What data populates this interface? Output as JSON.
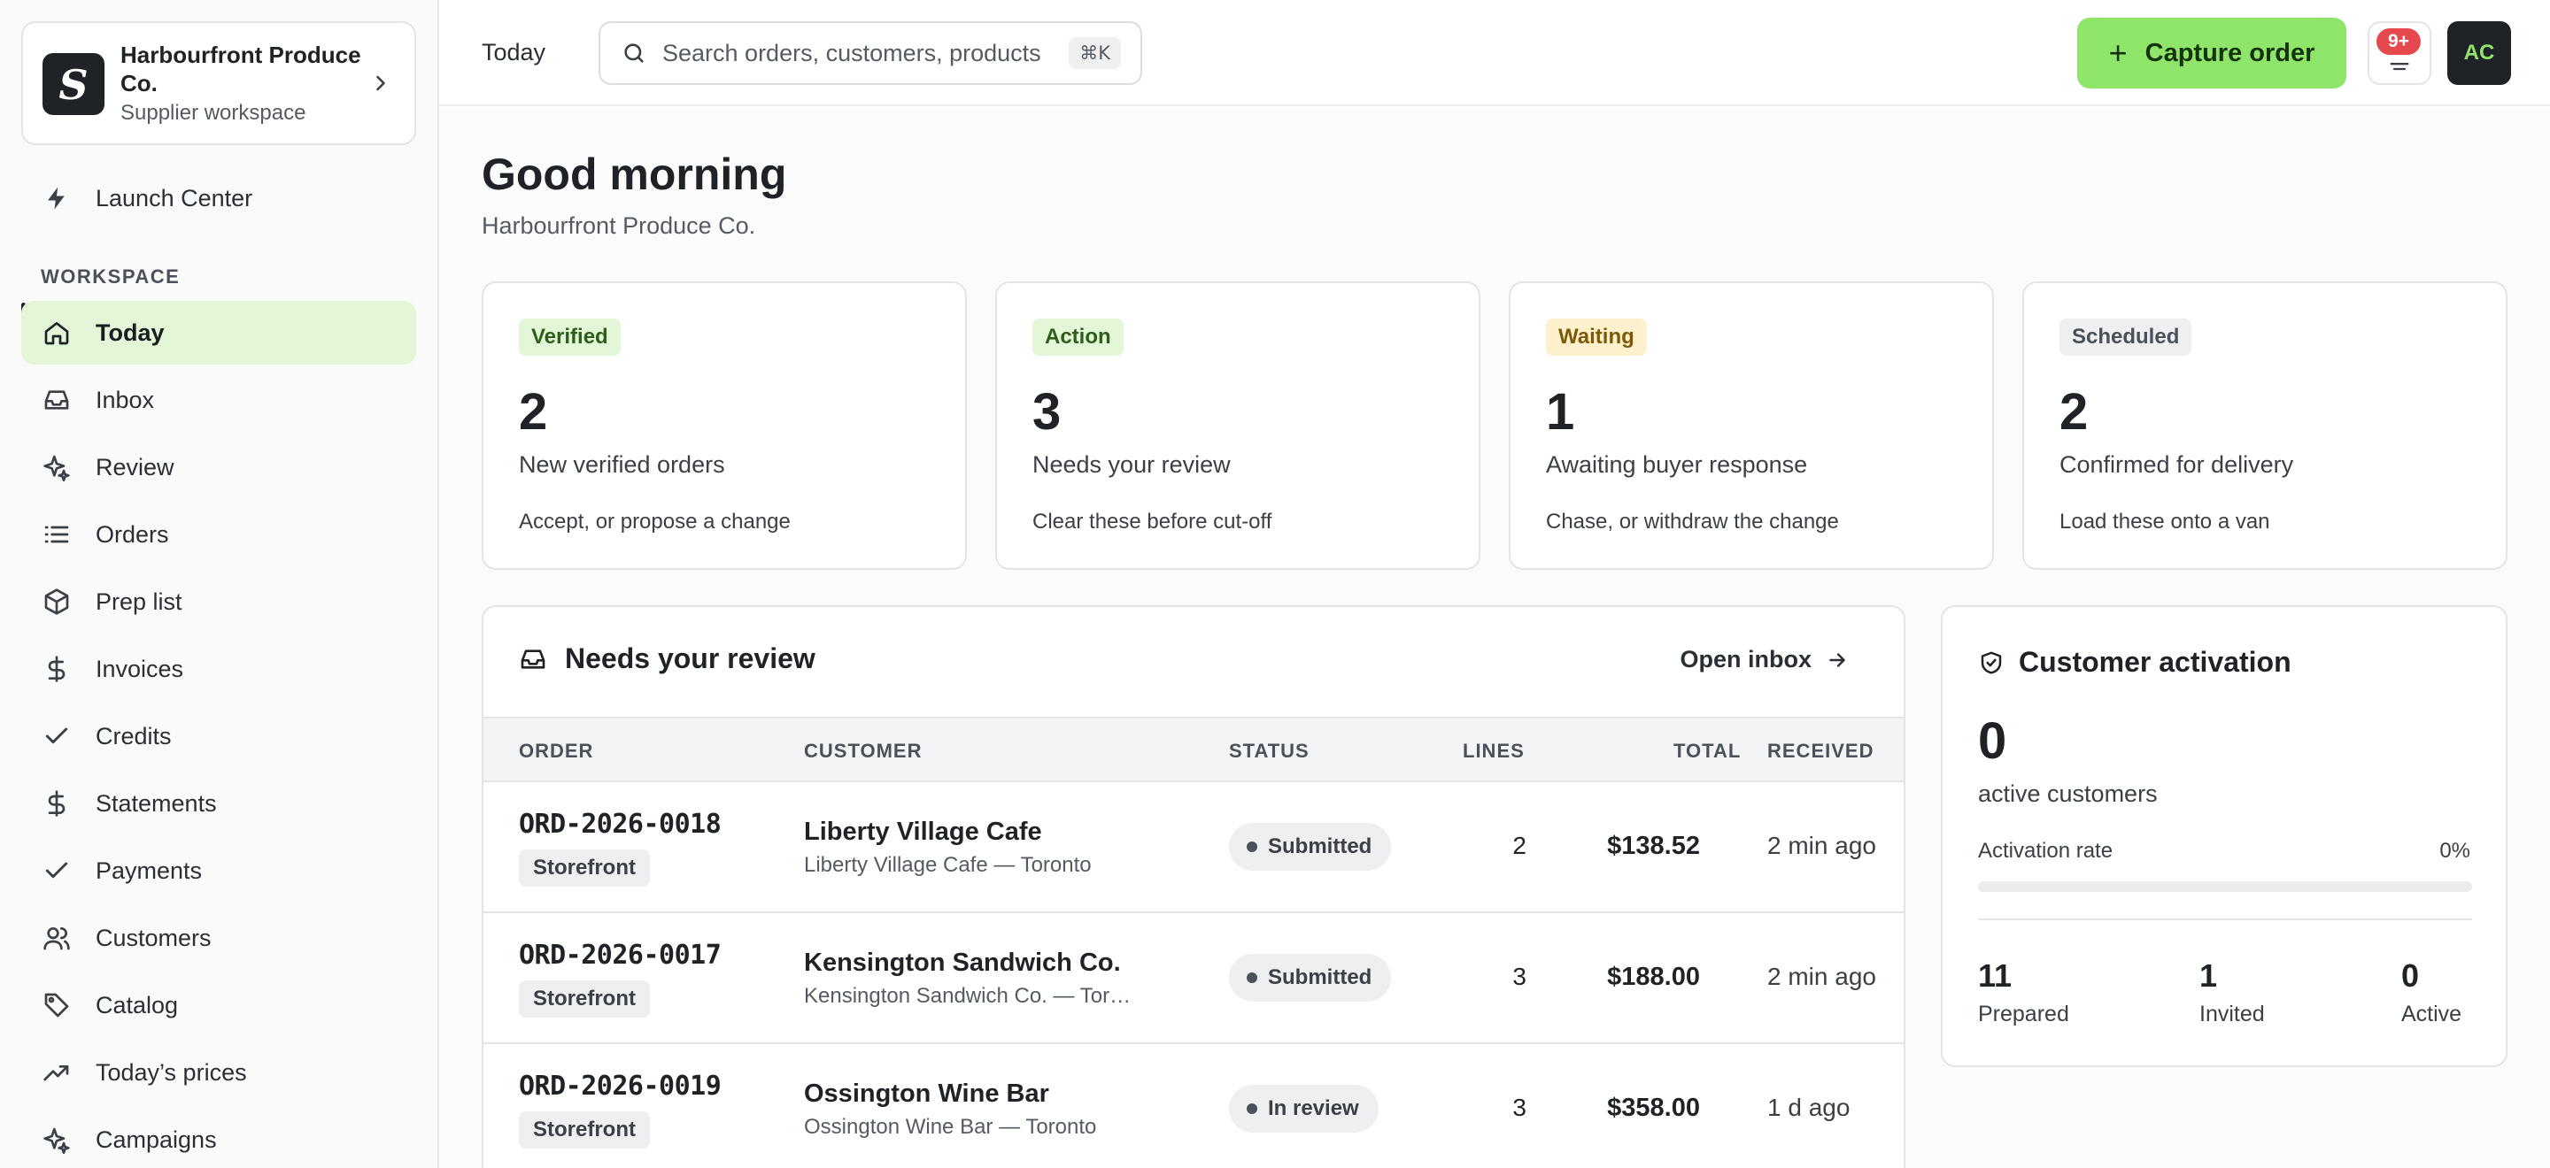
{
  "org": {
    "name": "Harbourfront Produce Co.",
    "workspace": "Supplier workspace"
  },
  "nav": {
    "launch_center": "Launch Center",
    "section_label": "WORKSPACE",
    "items": [
      {
        "label": "Today",
        "icon": "home-icon",
        "active": true
      },
      {
        "label": "Inbox",
        "icon": "inbox-icon"
      },
      {
        "label": "Review",
        "icon": "sparkle-icon"
      },
      {
        "label": "Orders",
        "icon": "list-icon"
      },
      {
        "label": "Prep list",
        "icon": "box-icon"
      },
      {
        "label": "Invoices",
        "icon": "dollar-icon"
      },
      {
        "label": "Credits",
        "icon": "check-icon"
      },
      {
        "label": "Statements",
        "icon": "dollar-icon"
      },
      {
        "label": "Payments",
        "icon": "check-icon"
      },
      {
        "label": "Customers",
        "icon": "users-icon"
      },
      {
        "label": "Catalog",
        "icon": "tag-icon"
      },
      {
        "label": "Today’s prices",
        "icon": "trend-icon"
      },
      {
        "label": "Campaigns",
        "icon": "sparkle-icon"
      }
    ]
  },
  "topbar": {
    "crumb": "Today",
    "search_placeholder": "Search orders, customers, products",
    "search_shortcut": "⌘K",
    "capture_label": "Capture order",
    "notification_count": "9+",
    "avatar_initials": "AC"
  },
  "main": {
    "greeting": "Good morning",
    "subtitle": "Harbourfront Produce Co."
  },
  "stats": [
    {
      "pill": "Verified",
      "pill_bg": "#e3f6d7",
      "pill_color": "#2f5e1b",
      "value": "2",
      "title": "New verified orders",
      "hint": "Accept, or propose a change"
    },
    {
      "pill": "Action",
      "pill_bg": "#e3f6d7",
      "pill_color": "#2f5e1b",
      "value": "3",
      "title": "Needs your review",
      "hint": "Clear these before cut-off"
    },
    {
      "pill": "Waiting",
      "pill_bg": "#fdf0cc",
      "pill_color": "#7a5a06",
      "value": "1",
      "title": "Awaiting buyer response",
      "hint": "Chase, or withdraw the change"
    },
    {
      "pill": "Scheduled",
      "pill_bg": "#eeeff1",
      "pill_color": "#4b5159",
      "value": "2",
      "title": "Confirmed for delivery",
      "hint": "Load these onto a van"
    }
  ],
  "review": {
    "title": "Needs your review",
    "open_inbox": "Open inbox",
    "columns": {
      "order": "ORDER",
      "customer": "CUSTOMER",
      "status": "STATUS",
      "lines": "LINES",
      "total": "TOTAL",
      "received": "RECEIVED"
    },
    "rows": [
      {
        "id": "ORD-2026-0018",
        "source": "Storefront",
        "customer": "Liberty Village Cafe",
        "customer_sub": "Liberty Village Cafe — Toronto",
        "status": "Submitted",
        "lines": "2",
        "total": "$138.52",
        "received": "2 min ago"
      },
      {
        "id": "ORD-2026-0017",
        "source": "Storefront",
        "customer": "Kensington Sandwich Co.",
        "customer_sub": "Kensington Sandwich Co. — Tor…",
        "status": "Submitted",
        "lines": "3",
        "total": "$188.00",
        "received": "2 min ago"
      },
      {
        "id": "ORD-2026-0019",
        "source": "Storefront",
        "customer": "Ossington Wine Bar",
        "customer_sub": "Ossington Wine Bar — Toronto",
        "status": "In review",
        "lines": "3",
        "total": "$358.00",
        "received": "1 d ago"
      }
    ]
  },
  "activation": {
    "title": "Customer activation",
    "count": "0",
    "count_label": "active customers",
    "rate_label": "Activation rate",
    "rate_value": "0%",
    "rate_fraction": 0,
    "prepared": "11",
    "prepared_label": "Prepared",
    "invited": "1",
    "invited_label": "Invited",
    "active": "0",
    "active_label": "Active"
  },
  "colors": {
    "accent": "#8fe56a",
    "nav_active_bg": "#e3f6d7",
    "badge": "#e5484d"
  }
}
